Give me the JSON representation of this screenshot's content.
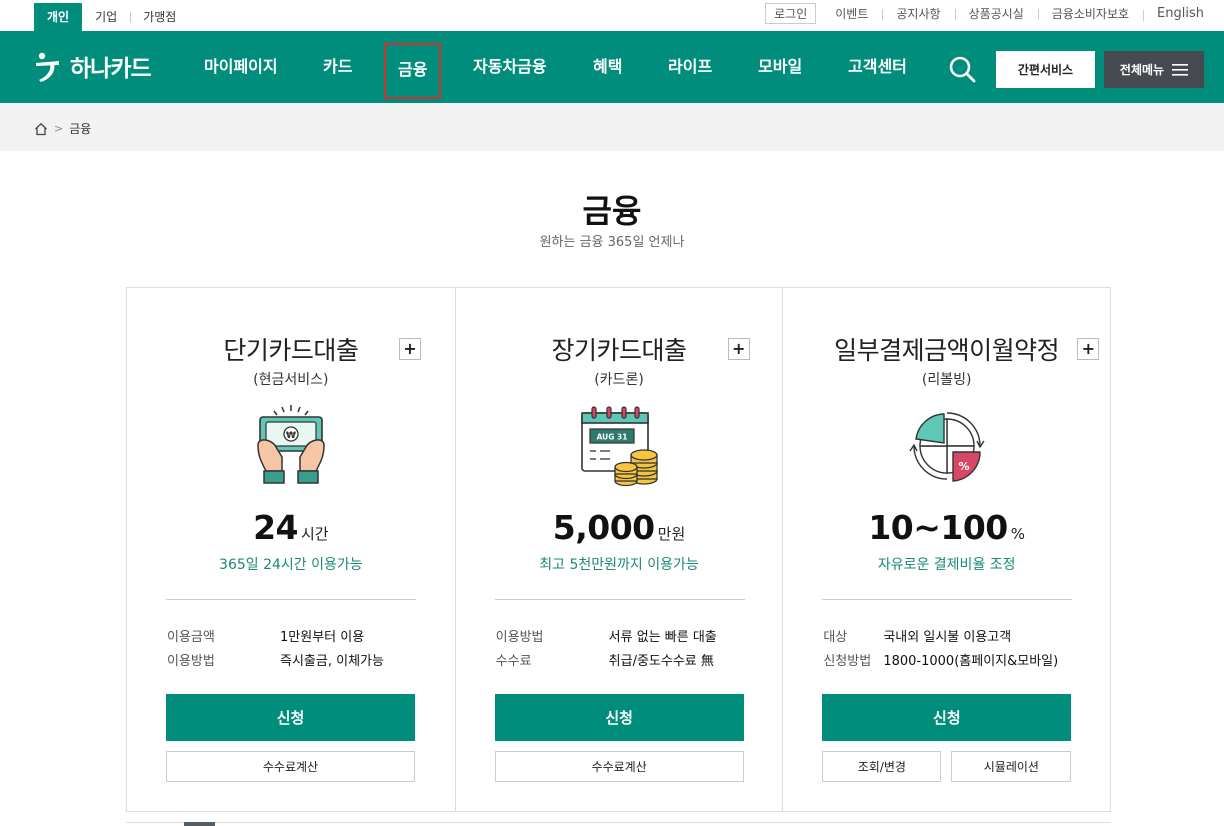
{
  "util": {
    "segments": [
      "개인",
      "기업",
      "가맹점"
    ],
    "login": "로그인",
    "links": [
      "이벤트",
      "공지사항",
      "상품공시실",
      "금융소비자보호",
      "English"
    ]
  },
  "brand": {
    "name": "하나카드"
  },
  "gnb": {
    "items": [
      "마이페이지",
      "카드",
      "금융",
      "자동차금융",
      "혜택",
      "라이프",
      "모바일",
      "고객센터"
    ],
    "quick": "간편서비스",
    "all": "전체메뉴"
  },
  "breadcrumb": {
    "current": "금융"
  },
  "page": {
    "title": "금융",
    "subtitle": "원하는 금융 365일 언제나"
  },
  "cards": [
    {
      "title": "단기카드대출",
      "sub": "(현금서비스)",
      "figure": "24",
      "unit": "시간",
      "desc": "365일 24시간 이용가능",
      "rows": [
        {
          "k": "이용금액",
          "v": "1만원부터 이용"
        },
        {
          "k": "이용방법",
          "v": "즉시출금, 이체가능"
        }
      ],
      "apply": "신청",
      "buttons": [
        "수수료계산"
      ]
    },
    {
      "title": "장기카드대출",
      "sub": "(카드론)",
      "figure": "5,000",
      "unit": "만원",
      "desc": "최고 5천만원까지 이용가능",
      "calendar_label": "AUG 31",
      "rows": [
        {
          "k": "이용방법",
          "v": "서류 없는 빠른 대출"
        },
        {
          "k": "수수료",
          "v": "취급/중도수수료 無"
        }
      ],
      "apply": "신청",
      "buttons": [
        "수수료계산"
      ]
    },
    {
      "title": "일부결제금액이월약정",
      "sub": "(리볼빙)",
      "figure": "10~100",
      "unit": "%",
      "desc": "자유로운 결제비율 조정",
      "rows": [
        {
          "k": "대상",
          "v": "국내외 일시불 이용고객"
        },
        {
          "k": "신청방법",
          "v": "1800-1000(홈페이지&모바일)"
        }
      ],
      "apply": "신청",
      "buttons": [
        "조회/변경",
        "시뮬레이션"
      ]
    }
  ],
  "icons": {
    "won": "₩",
    "percent": "%"
  },
  "colors": {
    "brand": "#008d7c",
    "dark": "#444a4f",
    "accent": "#d0312d"
  }
}
